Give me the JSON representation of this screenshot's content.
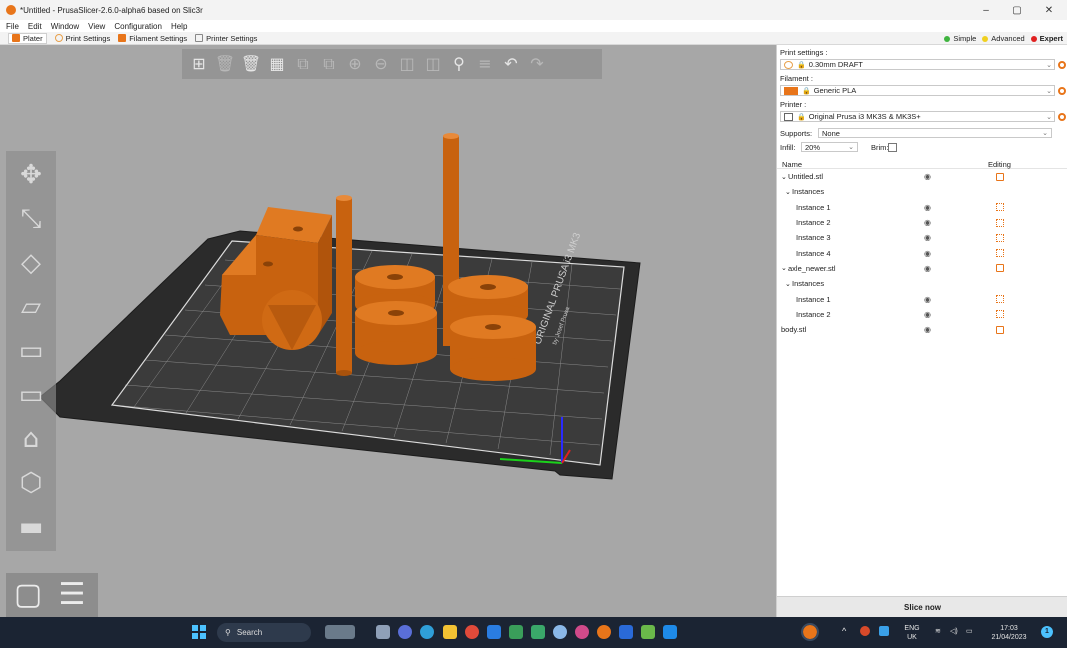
{
  "window": {
    "title": "*Untitled - PrusaSlicer-2.6.0-alpha6 based on Slic3r",
    "minimize": "–",
    "maximize": "▢",
    "close": "✕"
  },
  "menu": [
    "File",
    "Edit",
    "Window",
    "View",
    "Configuration",
    "Help"
  ],
  "tabs": [
    {
      "label": "Plater",
      "color": "#e8751a"
    },
    {
      "label": "Print Settings",
      "color": "#e8a04a"
    },
    {
      "label": "Filament Settings",
      "color": "#e8751a"
    },
    {
      "label": "Printer Settings",
      "color": "#888888"
    }
  ],
  "modes": [
    {
      "label": "Simple",
      "color": "#3fb43f"
    },
    {
      "label": "Advanced",
      "color": "#f0d020"
    },
    {
      "label": "Expert",
      "color": "#e02020"
    }
  ],
  "panel": {
    "print_settings_label": "Print settings :",
    "print_settings_value": "0.30mm DRAFT",
    "filament_label": "Filament :",
    "filament_value": "Generic PLA",
    "filament_color": "#e8751a",
    "printer_label": "Printer :",
    "printer_value": "Original Prusa i3 MK3S & MK3S+",
    "supports_label": "Supports:",
    "supports_value": "None",
    "infill_label": "Infill:",
    "infill_value": "20%",
    "brim_label": "Brim:",
    "col_name": "Name",
    "col_editing": "Editing",
    "slice_button": "Slice now"
  },
  "objects": [
    {
      "name": "Untitled.stl",
      "indent": 0,
      "expander": "⌄",
      "type": "obj"
    },
    {
      "name": "Instances",
      "indent": 1,
      "expander": "⌄",
      "type": "group"
    },
    {
      "name": "Instance 1",
      "indent": 2,
      "expander": "",
      "type": "inst"
    },
    {
      "name": "Instance 2",
      "indent": 2,
      "expander": "",
      "type": "inst"
    },
    {
      "name": "Instance 3",
      "indent": 2,
      "expander": "",
      "type": "inst"
    },
    {
      "name": "Instance 4",
      "indent": 2,
      "expander": "",
      "type": "inst"
    },
    {
      "name": "axle_newer.stl",
      "indent": 0,
      "expander": "⌄",
      "type": "obj"
    },
    {
      "name": "Instances",
      "indent": 1,
      "expander": "⌄",
      "type": "group"
    },
    {
      "name": "Instance 1",
      "indent": 2,
      "expander": "",
      "type": "inst"
    },
    {
      "name": "Instance 2",
      "indent": 2,
      "expander": "",
      "type": "inst"
    },
    {
      "name": "body.stl",
      "indent": 0,
      "expander": "",
      "type": "obj"
    }
  ],
  "bed": {
    "label": "ORIGINAL PRUSA i3 MK3",
    "sublabel": "by Josef Prusa"
  },
  "toolbar_icons": [
    "add-icon",
    "delete-icon",
    "delete-all-icon",
    "arrange-icon",
    "copy-icon",
    "paste-icon",
    "add-instance-icon",
    "remove-instance-icon",
    "split-objects-icon",
    "split-parts-icon",
    "search-icon",
    "layers-icon",
    "undo-icon",
    "redo-icon"
  ],
  "left_tool_icons": [
    "move-icon",
    "scale-icon",
    "rotate-icon",
    "place-on-face-icon",
    "cut-icon",
    "paint-supports-icon",
    "seam-painting-icon",
    "mmu-painting-icon",
    "measure-icon"
  ],
  "taskbar": {
    "search_label": "Search",
    "lang_top": "ENG",
    "lang_bottom": "UK",
    "time": "17:03",
    "date": "21/04/2023",
    "notification_count": "1"
  }
}
